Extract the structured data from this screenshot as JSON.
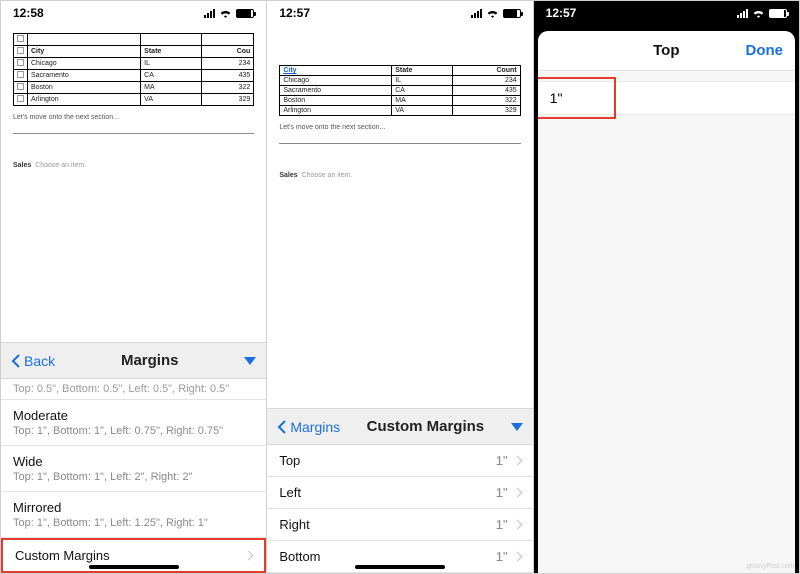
{
  "panel1": {
    "time": "12:58",
    "table": {
      "headers": [
        "City",
        "State",
        "Cou"
      ],
      "rows": [
        [
          "Chicago",
          "IL",
          "234"
        ],
        [
          "Sacramento",
          "CA",
          "435"
        ],
        [
          "Boston",
          "MA",
          "322"
        ],
        [
          "Arlington",
          "VA",
          "329"
        ]
      ]
    },
    "section_text": "Let's move onto the next section...",
    "sales_label": "Sales",
    "sales_hint": "Choose an item.",
    "sheet": {
      "back_label": "Back",
      "title": "Margins",
      "truncated": "Top: 0.5\", Bottom: 0.5\", Left: 0.5\", Right: 0.5\"",
      "options": [
        {
          "name": "Moderate",
          "detail": "Top: 1\", Bottom: 1\", Left: 0.75\", Right: 0.75\""
        },
        {
          "name": "Wide",
          "detail": "Top: 1\", Bottom: 1\", Left: 2\", Right: 2\""
        },
        {
          "name": "Mirrored",
          "detail": "Top: 1\", Bottom: 1\", Left: 1.25\", Right: 1\""
        }
      ],
      "custom_label": "Custom Margins"
    }
  },
  "panel2": {
    "time": "12:57",
    "table": {
      "headers": [
        "City",
        "State",
        "Count"
      ],
      "rows": [
        [
          "Chicago",
          "IL",
          "234"
        ],
        [
          "Sacramento",
          "CA",
          "435"
        ],
        [
          "Boston",
          "MA",
          "322"
        ],
        [
          "Arlington",
          "VA",
          "329"
        ]
      ]
    },
    "section_text": "Let's move onto the next section...",
    "sales_label": "Sales",
    "sales_hint": "Choose an item.",
    "sheet": {
      "back_label": "Margins",
      "title": "Custom Margins",
      "rows": [
        {
          "label": "Top",
          "value": "1\""
        },
        {
          "label": "Left",
          "value": "1\""
        },
        {
          "label": "Right",
          "value": "1\""
        },
        {
          "label": "Bottom",
          "value": "1\""
        }
      ]
    }
  },
  "panel3": {
    "time": "12:57",
    "nav_title": "Top",
    "done_label": "Done",
    "field_value": "1\""
  },
  "watermark": "groovyPost.com"
}
